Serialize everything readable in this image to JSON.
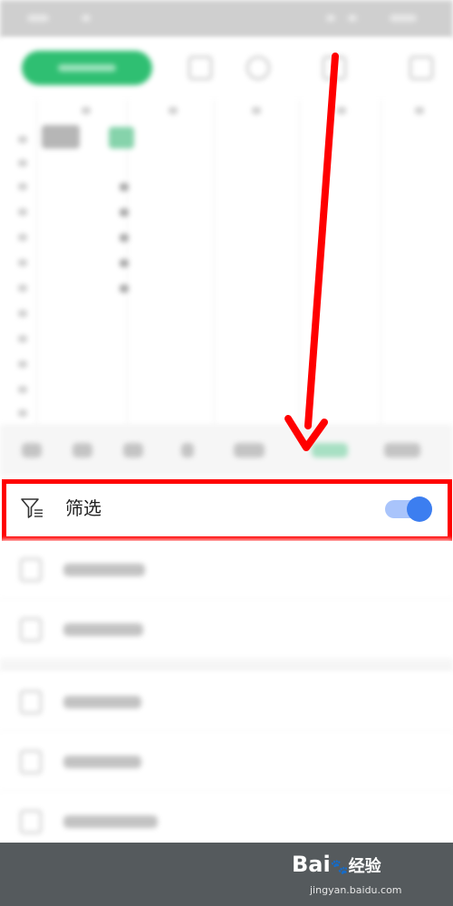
{
  "filter_row": {
    "label": "筛选",
    "icon": "filter-icon",
    "toggle_on": true
  },
  "watermark": {
    "brand": "Bai",
    "brand_suffix": "经验",
    "url": "jingyan.baidu.com"
  },
  "colors": {
    "accent_green": "#2fbf72",
    "annotation_red": "#ff0000",
    "toggle_blue": "#3c7ef0",
    "toggle_track": "#a9c4fb"
  }
}
